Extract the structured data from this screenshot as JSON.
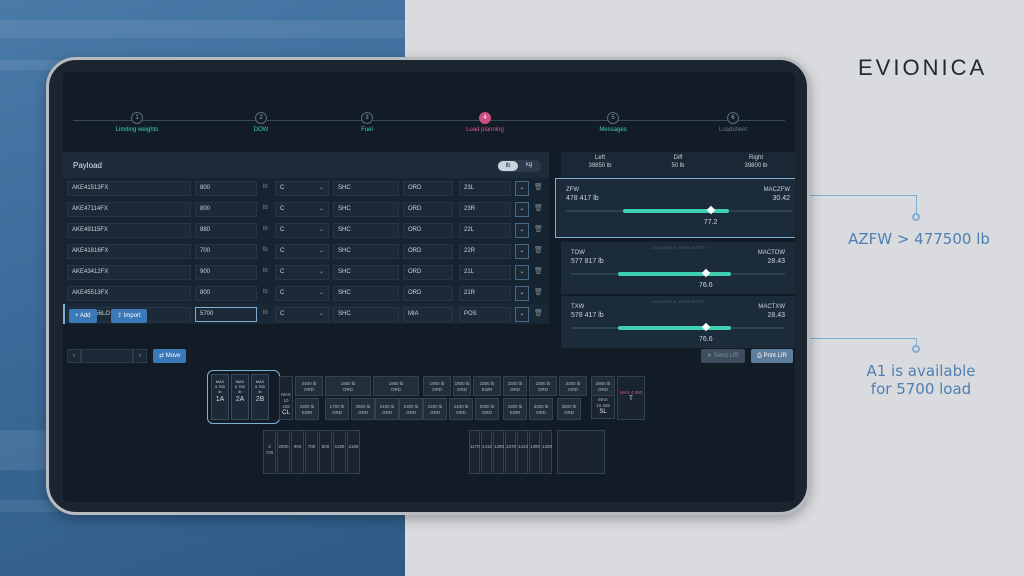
{
  "brand": "EVIONICA",
  "callouts": {
    "azfw": "AZFW > 477500 lb",
    "a1_line1": "A1 is available",
    "a1_line2": "for 5700 load"
  },
  "steps": [
    {
      "num": "1",
      "label": "Limiting weights"
    },
    {
      "num": "2",
      "label": "DOW"
    },
    {
      "num": "3",
      "label": "Fuel"
    },
    {
      "num": "4",
      "label": "Load planning"
    },
    {
      "num": "5",
      "label": "Messages"
    },
    {
      "num": "6",
      "label": "Loadsheet"
    }
  ],
  "payload": {
    "title": "Payload",
    "unit_lb": "lb",
    "unit_kg": "kg",
    "rows": [
      {
        "id": "AKE41513FX",
        "weight": "800",
        "unit": "lb",
        "cls": "C",
        "shc": "SHC",
        "dest": "ORD",
        "pos": "23L"
      },
      {
        "id": "AKE47114FX",
        "weight": "800",
        "unit": "lb",
        "cls": "C",
        "shc": "SHC",
        "dest": "ORD",
        "pos": "23R"
      },
      {
        "id": "AKE49115FX",
        "weight": "880",
        "unit": "lb",
        "cls": "C",
        "shc": "SHC",
        "dest": "ORD",
        "pos": "22L"
      },
      {
        "id": "AKE41816FX",
        "weight": "700",
        "unit": "lb",
        "cls": "C",
        "shc": "SHC",
        "dest": "ORD",
        "pos": "22R"
      },
      {
        "id": "AKE43412FX",
        "weight": "900",
        "unit": "lb",
        "cls": "C",
        "shc": "SHC",
        "dest": "ORD",
        "pos": "21L"
      },
      {
        "id": "AKE45513FX",
        "weight": "800",
        "unit": "lb",
        "cls": "C",
        "shc": "SHC",
        "dest": "ORD",
        "pos": "21R"
      },
      {
        "id": "PMC23456LO",
        "weight": "5700",
        "unit": "lb",
        "cls": "C",
        "shc": "SHC",
        "dest": "MIA",
        "pos": "POS"
      }
    ],
    "add_label": "+ Add",
    "import_label": "Import"
  },
  "balance": {
    "left_label": "Left",
    "left_value": "39850 lb",
    "diff_label": "Diff",
    "diff_value": "50 lb",
    "right_label": "Right",
    "right_value": "39800 lb"
  },
  "cards": [
    {
      "l1": "ZFW",
      "l2": "478 417 lb",
      "r1": "MACZFW",
      "r2": "30.42",
      "val": "77.2",
      "pos": 0.64,
      "fill_from": 0.25,
      "fill_to": 0.72,
      "tiny": ""
    },
    {
      "l1": "TOW",
      "l2": "577 817 lb",
      "r1": "MACTOW",
      "r2": "28.43",
      "val": "76.6",
      "pos": 0.63,
      "fill_from": 0.22,
      "fill_to": 0.75,
      "tiny": "Limit 28500 lb, PMAX 55 TRD"
    },
    {
      "l1": "TXW",
      "l2": "578 417 lb",
      "r1": "MACTXW",
      "r2": "28.43",
      "val": "76.6",
      "pos": 0.63,
      "fill_from": 0.22,
      "fill_to": 0.75,
      "tiny": "Limit 28500 lb, PMAX 55 TRD"
    }
  ],
  "bottom": {
    "move_label": "Move",
    "send_label": "Send LIR",
    "print_label": "Print LIR",
    "ba": [
      {
        "line1": "MAX",
        "line2": "5 760",
        "line3": "lb",
        "pos": "1A"
      },
      {
        "line1": "MAX",
        "line2": "5 760",
        "line3": "lb",
        "pos": "2A"
      },
      {
        "line1": "MAX",
        "line2": "5 760",
        "line3": "lb",
        "pos": "2B"
      }
    ],
    "upper": [
      {
        "w": "4400 lb",
        "t": "ORD"
      },
      {
        "w": "1800 lb",
        "t": "ORD"
      },
      {
        "w": "1900 lb",
        "t": "ORD"
      },
      {
        "w": "1900 lb",
        "t": "ORD"
      },
      {
        "w": "1800 lb",
        "t": "ORD"
      },
      {
        "w": "3300 lb",
        "t": "EWR"
      },
      {
        "w": "3300 lb",
        "t": "ORD"
      },
      {
        "w": "3300 lb",
        "t": "ORD"
      },
      {
        "w": "3300 lb",
        "t": "ORD"
      },
      {
        "w": "2900 lb",
        "t": "ORD"
      }
    ],
    "lower": [
      {
        "w": "3300 lb",
        "t": "EWR"
      },
      {
        "w": "1700 lb",
        "t": "ORD"
      },
      {
        "w": "2500 lb",
        "t": "ORD"
      },
      {
        "w": "2400 lb",
        "t": "ORD"
      },
      {
        "w": "2300 lb",
        "t": "ORD"
      },
      {
        "w": "2200 lb",
        "t": "ORD"
      },
      {
        "w": "2100 lb",
        "t": "ORD"
      },
      {
        "w": "2000 lb",
        "t": "ORD"
      },
      {
        "w": "3300 lb",
        "t": "EWR"
      },
      {
        "w": "3300 lb",
        "t": "ORD"
      },
      {
        "w": "3500 lb",
        "t": "ORD"
      }
    ],
    "cl": {
      "max": "MAX",
      "w": "10 426",
      "pos": "CL"
    },
    "sl": {
      "max": "MAX",
      "w": "10 426",
      "pos": "SL"
    },
    "t": {
      "label": "MAX 4 000",
      "pos": "T"
    },
    "lowerhold_left": [
      "2 700",
      "2800",
      "900",
      "700",
      "800",
      "1190",
      "1190"
    ],
    "lowerhold_right": [
      "1170",
      "1410",
      "1390",
      "1370",
      "1410",
      "1390",
      "1330"
    ]
  },
  "colors": {
    "accent": "#3fd0b0",
    "active_step": "#d65b8a",
    "callout": "#4f7fb3"
  }
}
